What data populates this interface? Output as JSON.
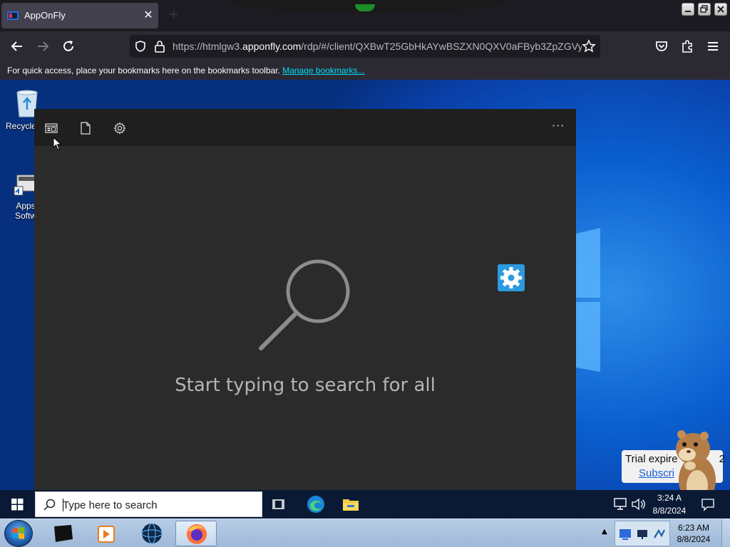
{
  "browser": {
    "tab": {
      "title": "AppOnFly",
      "close_glyph": "✕",
      "favicon": "apponfly-favicon"
    },
    "new_tab_glyph": "+",
    "url": {
      "prefix": "https://htmlgw3.",
      "host": "apponfly.com",
      "path": "/rdp/#/client/QXBwT25GbHkAYwBSZXN0QXV0aFByb3ZpZGVy"
    },
    "bookmarks_bar": {
      "message": "For quick access, place your bookmarks here on the bookmarks toolbar.",
      "link": "Manage bookmarks..."
    },
    "icons": [
      "back-icon",
      "forward-icon",
      "reload-icon",
      "tracking-shield-icon",
      "lock-icon",
      "star-icon",
      "pocket-icon",
      "extensions-icon",
      "menu-icon"
    ]
  },
  "desktop": {
    "icons": [
      {
        "label": "Recycle",
        "icon": "recycle-bin-icon"
      },
      {
        "label": "Apps\nSoftw",
        "icon": "apps-software-icon"
      }
    ]
  },
  "search_flyout": {
    "top_icons": [
      "apps-icon",
      "documents-icon",
      "settings-icon"
    ],
    "more_glyph": "···",
    "empty_message": "Start typing to search for all",
    "accent": "#2c9ae0"
  },
  "trial_popup": {
    "text": "Trial expire",
    "suffix": "2",
    "link": "Subscri"
  },
  "taskbar_win10": {
    "search_placeholder": "Type here to search",
    "clock_time": "3:24 A",
    "clock_date": "8/8/2024",
    "pinned": [
      "task-view-icon",
      "edge-icon",
      "file-explorer-icon"
    ],
    "tray": [
      "network-icon",
      "volume-icon",
      "notifications-icon"
    ]
  },
  "taskbar_win7": {
    "clock_time": "6:23 AM",
    "clock_date": "8/8/2024",
    "buttons": [
      "monitor-app-icon",
      "media-player-icon",
      "globe-icon",
      "firefox-icon"
    ],
    "tray_toggle": "▲"
  }
}
